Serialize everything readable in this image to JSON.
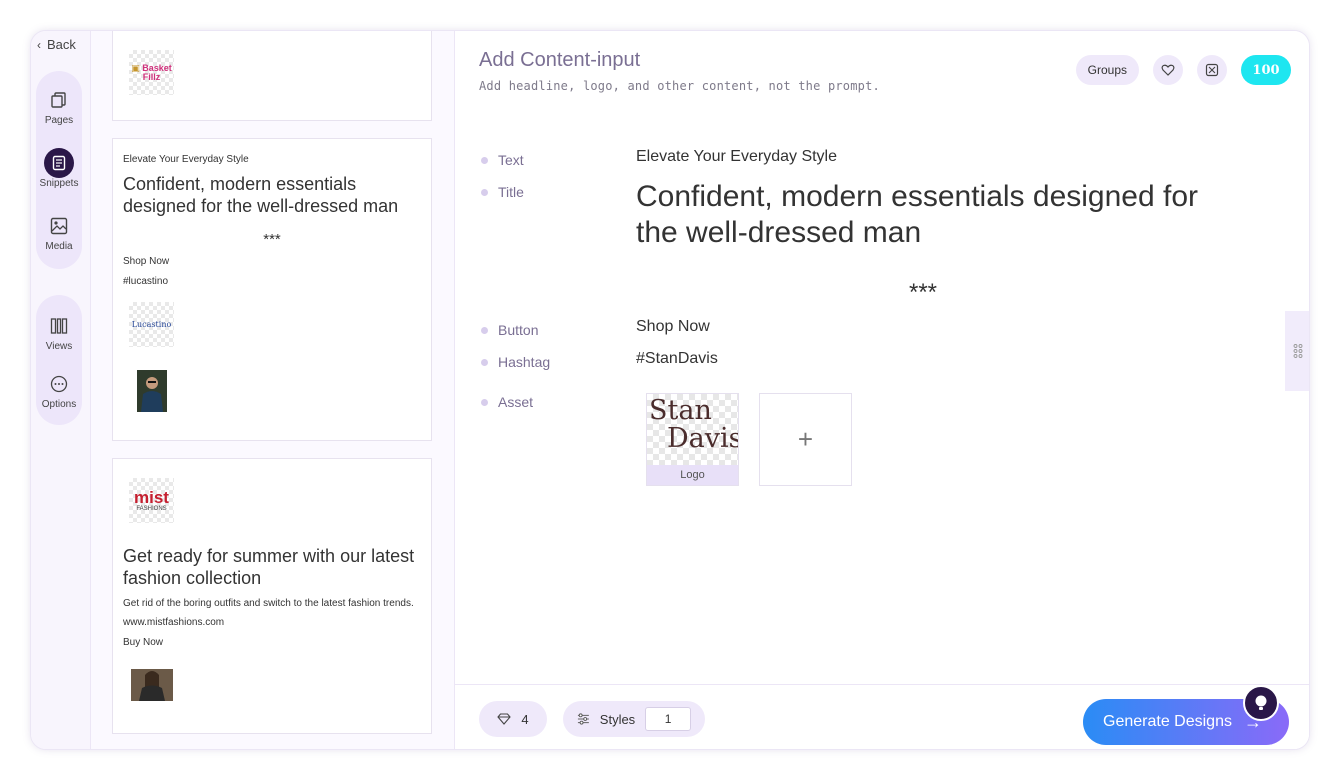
{
  "rail": {
    "back_label": "Back",
    "items": [
      {
        "label": "Pages",
        "icon": "pages-icon"
      },
      {
        "label": "Snippets",
        "icon": "snippets-icon"
      },
      {
        "label": "Media",
        "icon": "media-icon"
      },
      {
        "label": "Views",
        "icon": "views-icon"
      },
      {
        "label": "Options",
        "icon": "options-icon"
      }
    ]
  },
  "snippets": {
    "card1": {
      "logo_text": "Basket Fillz"
    },
    "card2": {
      "eyebrow": "Elevate Your Everyday Style",
      "title": "Confident, modern essentials designed for the well-dressed man",
      "separator": "***",
      "button": "Shop Now",
      "hashtag": "#lucastino",
      "logo_text": "Lucastino"
    },
    "card3": {
      "logo_text_top": "mist",
      "logo_text_bottom": "FASHIONS",
      "title": "Get ready for summer with our latest fashion collection",
      "body": "Get rid of the boring outfits and switch to the latest fashion trends.",
      "url": "www.mistfashions.com",
      "button": "Buy Now"
    }
  },
  "main": {
    "title": "Add Content-input",
    "subtitle": "Add headline, logo, and other content, not the prompt.",
    "groups_label": "Groups",
    "credits": "100",
    "fields": {
      "text_label": "Text",
      "text_value": "Elevate Your Everyday Style",
      "title_label": "Title",
      "title_value": "Confident, modern essentials designed for the well-dressed man",
      "separator": "***",
      "button_label": "Button",
      "button_value": "Shop Now",
      "hashtag_label": "Hashtag",
      "hashtag_value": "#StanDavis",
      "asset_label": "Asset"
    },
    "asset": {
      "logo_line1": "Stan",
      "logo_line2": "Davis",
      "caption": "Logo",
      "add_symbol": "+"
    }
  },
  "footer": {
    "likes_count": "4",
    "styles_label": "Styles",
    "styles_value": "1",
    "generate_label": "Generate Designs"
  },
  "colors": {
    "accent": "#2a1748",
    "credits": "#1ee6f0",
    "gen_start": "#2a8cf5",
    "gen_end": "#8a6af8"
  }
}
